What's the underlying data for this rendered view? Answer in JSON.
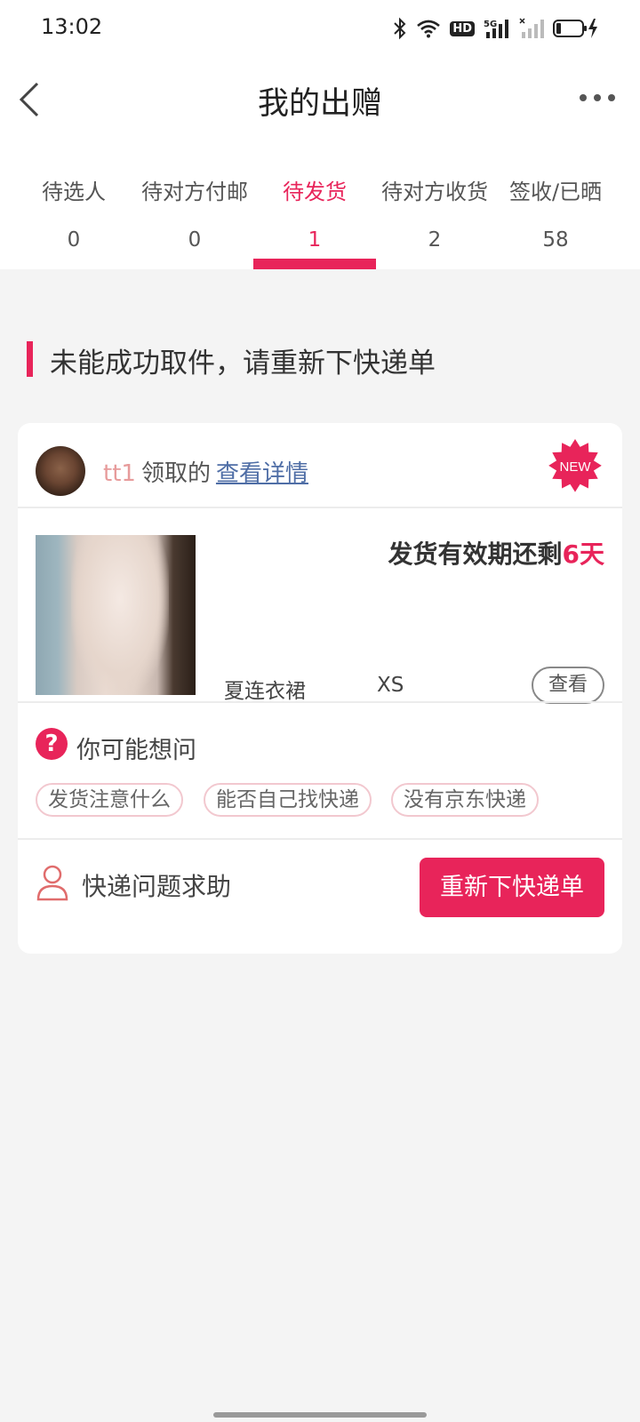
{
  "status_bar": {
    "time": "13:02",
    "icons": [
      "bluetooth-icon",
      "wifi-icon",
      "hd-icon",
      "signal-5g-icon",
      "signal-weak-icon",
      "battery-charging-icon"
    ],
    "hd_text": "HD",
    "network_text": "5G"
  },
  "header": {
    "title": "我的出赠",
    "back_icon": "chevron-left-icon",
    "more_icon": "more-dots-icon"
  },
  "tabs": [
    {
      "label": "待选人",
      "count": "0"
    },
    {
      "label": "待对方付邮",
      "count": "0"
    },
    {
      "label": "待发货",
      "count": "1",
      "active": true
    },
    {
      "label": "待对方收货",
      "count": "2"
    },
    {
      "label": "签收/已晒",
      "count": "58"
    }
  ],
  "section": {
    "title": "未能成功取件，请重新下快递单"
  },
  "card": {
    "user": {
      "name": "tt1",
      "claimed_text": "领取的",
      "details_link": "查看详情"
    },
    "badge": "NEW",
    "ship_deadline_prefix": "发货有效期还剩",
    "ship_deadline_days": "6天",
    "product": {
      "name": "夏连衣裙",
      "size": "XS",
      "view_label": "查看"
    },
    "qa": {
      "title": "你可能想问",
      "icon_text": "?",
      "chips": [
        "发货注意什么",
        "能否自己找快递",
        "没有京东快递"
      ]
    },
    "help": {
      "text": "快递问题求助",
      "button": "重新下快递单"
    }
  },
  "colors": {
    "accent": "#e8245a",
    "link": "#4f6ea6",
    "background": "#f4f4f4"
  }
}
